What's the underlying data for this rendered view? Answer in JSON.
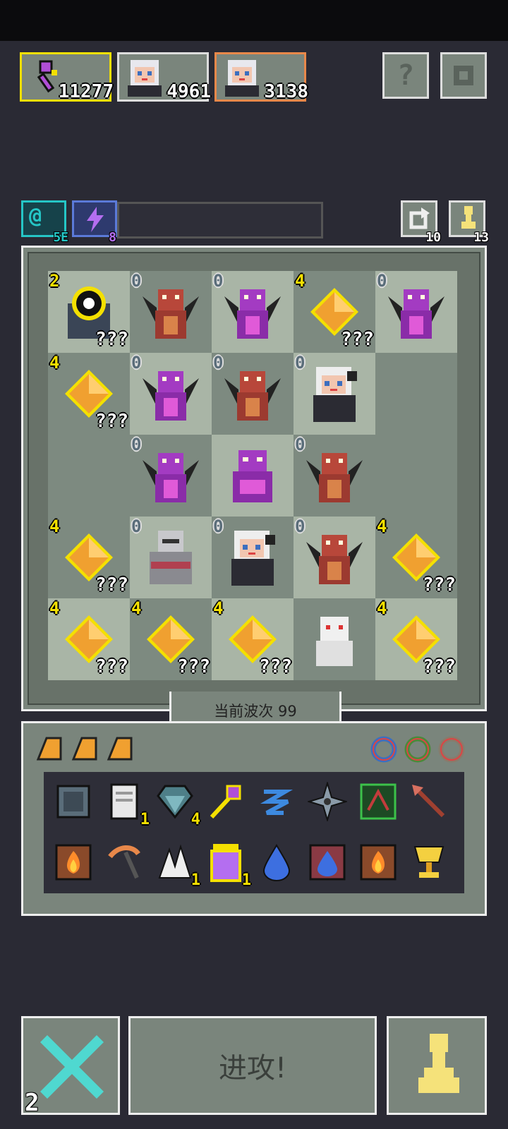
{
  "resources": [
    {
      "value": "11277",
      "icon": "gem-tool-icon"
    },
    {
      "value": "4961",
      "icon": "character-portrait"
    },
    {
      "value": "3138",
      "icon": "character-portrait"
    }
  ],
  "buttons": {
    "help_label": "?",
    "settings_icon": "gear-icon"
  },
  "tags": {
    "speed_label": "5E",
    "energy_label": "8",
    "counter_a": "10",
    "counter_b": "13"
  },
  "board": {
    "cells": [
      {
        "num": "2",
        "numColor": "y",
        "q": "???",
        "sprite": "eye-orb"
      },
      {
        "num": "0",
        "numColor": "b",
        "q": "",
        "sprite": "red-dragon"
      },
      {
        "num": "0",
        "numColor": "b",
        "q": "",
        "sprite": "purple-dragon"
      },
      {
        "num": "4",
        "numColor": "y",
        "q": "???",
        "sprite": "crystal"
      },
      {
        "num": "0",
        "numColor": "b",
        "q": "",
        "sprite": "purple-dragon"
      },
      {
        "num": "4",
        "numColor": "y",
        "q": "???",
        "sprite": "crystal"
      },
      {
        "num": "0",
        "numColor": "b",
        "q": "",
        "sprite": "purple-dragon"
      },
      {
        "num": "0",
        "numColor": "b",
        "q": "",
        "sprite": "red-dragon"
      },
      {
        "num": "0",
        "numColor": "b",
        "q": "",
        "sprite": "girl"
      },
      {
        "num": "",
        "numColor": "b",
        "q": "",
        "sprite": "empty"
      },
      {
        "num": "",
        "numColor": "b",
        "q": "",
        "sprite": "empty"
      },
      {
        "num": "0",
        "numColor": "b",
        "q": "",
        "sprite": "purple-dragon"
      },
      {
        "num": "",
        "numColor": "b",
        "q": "",
        "sprite": "purple-beast"
      },
      {
        "num": "0",
        "numColor": "b",
        "q": "",
        "sprite": "red-dragon"
      },
      {
        "num": "",
        "numColor": "b",
        "q": "",
        "sprite": "empty"
      },
      {
        "num": "4",
        "numColor": "y",
        "q": "???",
        "sprite": "crystal"
      },
      {
        "num": "0",
        "numColor": "b",
        "q": "",
        "sprite": "knight"
      },
      {
        "num": "0",
        "numColor": "b",
        "q": "",
        "sprite": "girl"
      },
      {
        "num": "0",
        "numColor": "b",
        "q": "",
        "sprite": "red-dragon"
      },
      {
        "num": "4",
        "numColor": "y",
        "q": "???",
        "sprite": "crystal"
      },
      {
        "num": "4",
        "numColor": "y",
        "q": "???",
        "sprite": "crystal"
      },
      {
        "num": "4",
        "numColor": "y",
        "q": "???",
        "sprite": "crystal"
      },
      {
        "num": "4",
        "numColor": "y",
        "q": "???",
        "sprite": "crystal"
      },
      {
        "num": "",
        "numColor": "b",
        "q": "",
        "sprite": "white-ghost"
      },
      {
        "num": "4",
        "numColor": "y",
        "q": "???",
        "sprite": "crystal"
      }
    ]
  },
  "wave_label": "当前波次 99",
  "inventory": {
    "items": [
      {
        "icon": "scroll-box-icon",
        "count": ""
      },
      {
        "icon": "paper-scroll-icon",
        "count": "1"
      },
      {
        "icon": "teal-gem-icon",
        "count": "4"
      },
      {
        "icon": "purple-wand-icon",
        "count": ""
      },
      {
        "icon": "blue-wind-icon",
        "count": ""
      },
      {
        "icon": "shuriken-icon",
        "count": ""
      },
      {
        "icon": "green-rune-icon",
        "count": ""
      },
      {
        "icon": "arrow-icon",
        "count": ""
      },
      {
        "icon": "fire-card-icon",
        "count": ""
      },
      {
        "icon": "pickaxe-icon",
        "count": ""
      },
      {
        "icon": "white-wing-icon",
        "count": "1"
      },
      {
        "icon": "potion-jar-icon",
        "count": "1"
      },
      {
        "icon": "water-drop-icon",
        "count": ""
      },
      {
        "icon": "water-card-icon",
        "count": ""
      },
      {
        "icon": "fire-card-icon",
        "count": ""
      },
      {
        "icon": "gold-trophy-icon",
        "count": ""
      }
    ]
  },
  "bottom": {
    "cancel_count": "2",
    "attack_label": "进攻!",
    "pawn_icon": "pawn-icon"
  },
  "colors": {
    "yellow": "#f4e000",
    "orange": "#e8884a",
    "teal": "#25c6c6",
    "panel": "#7a857c"
  }
}
